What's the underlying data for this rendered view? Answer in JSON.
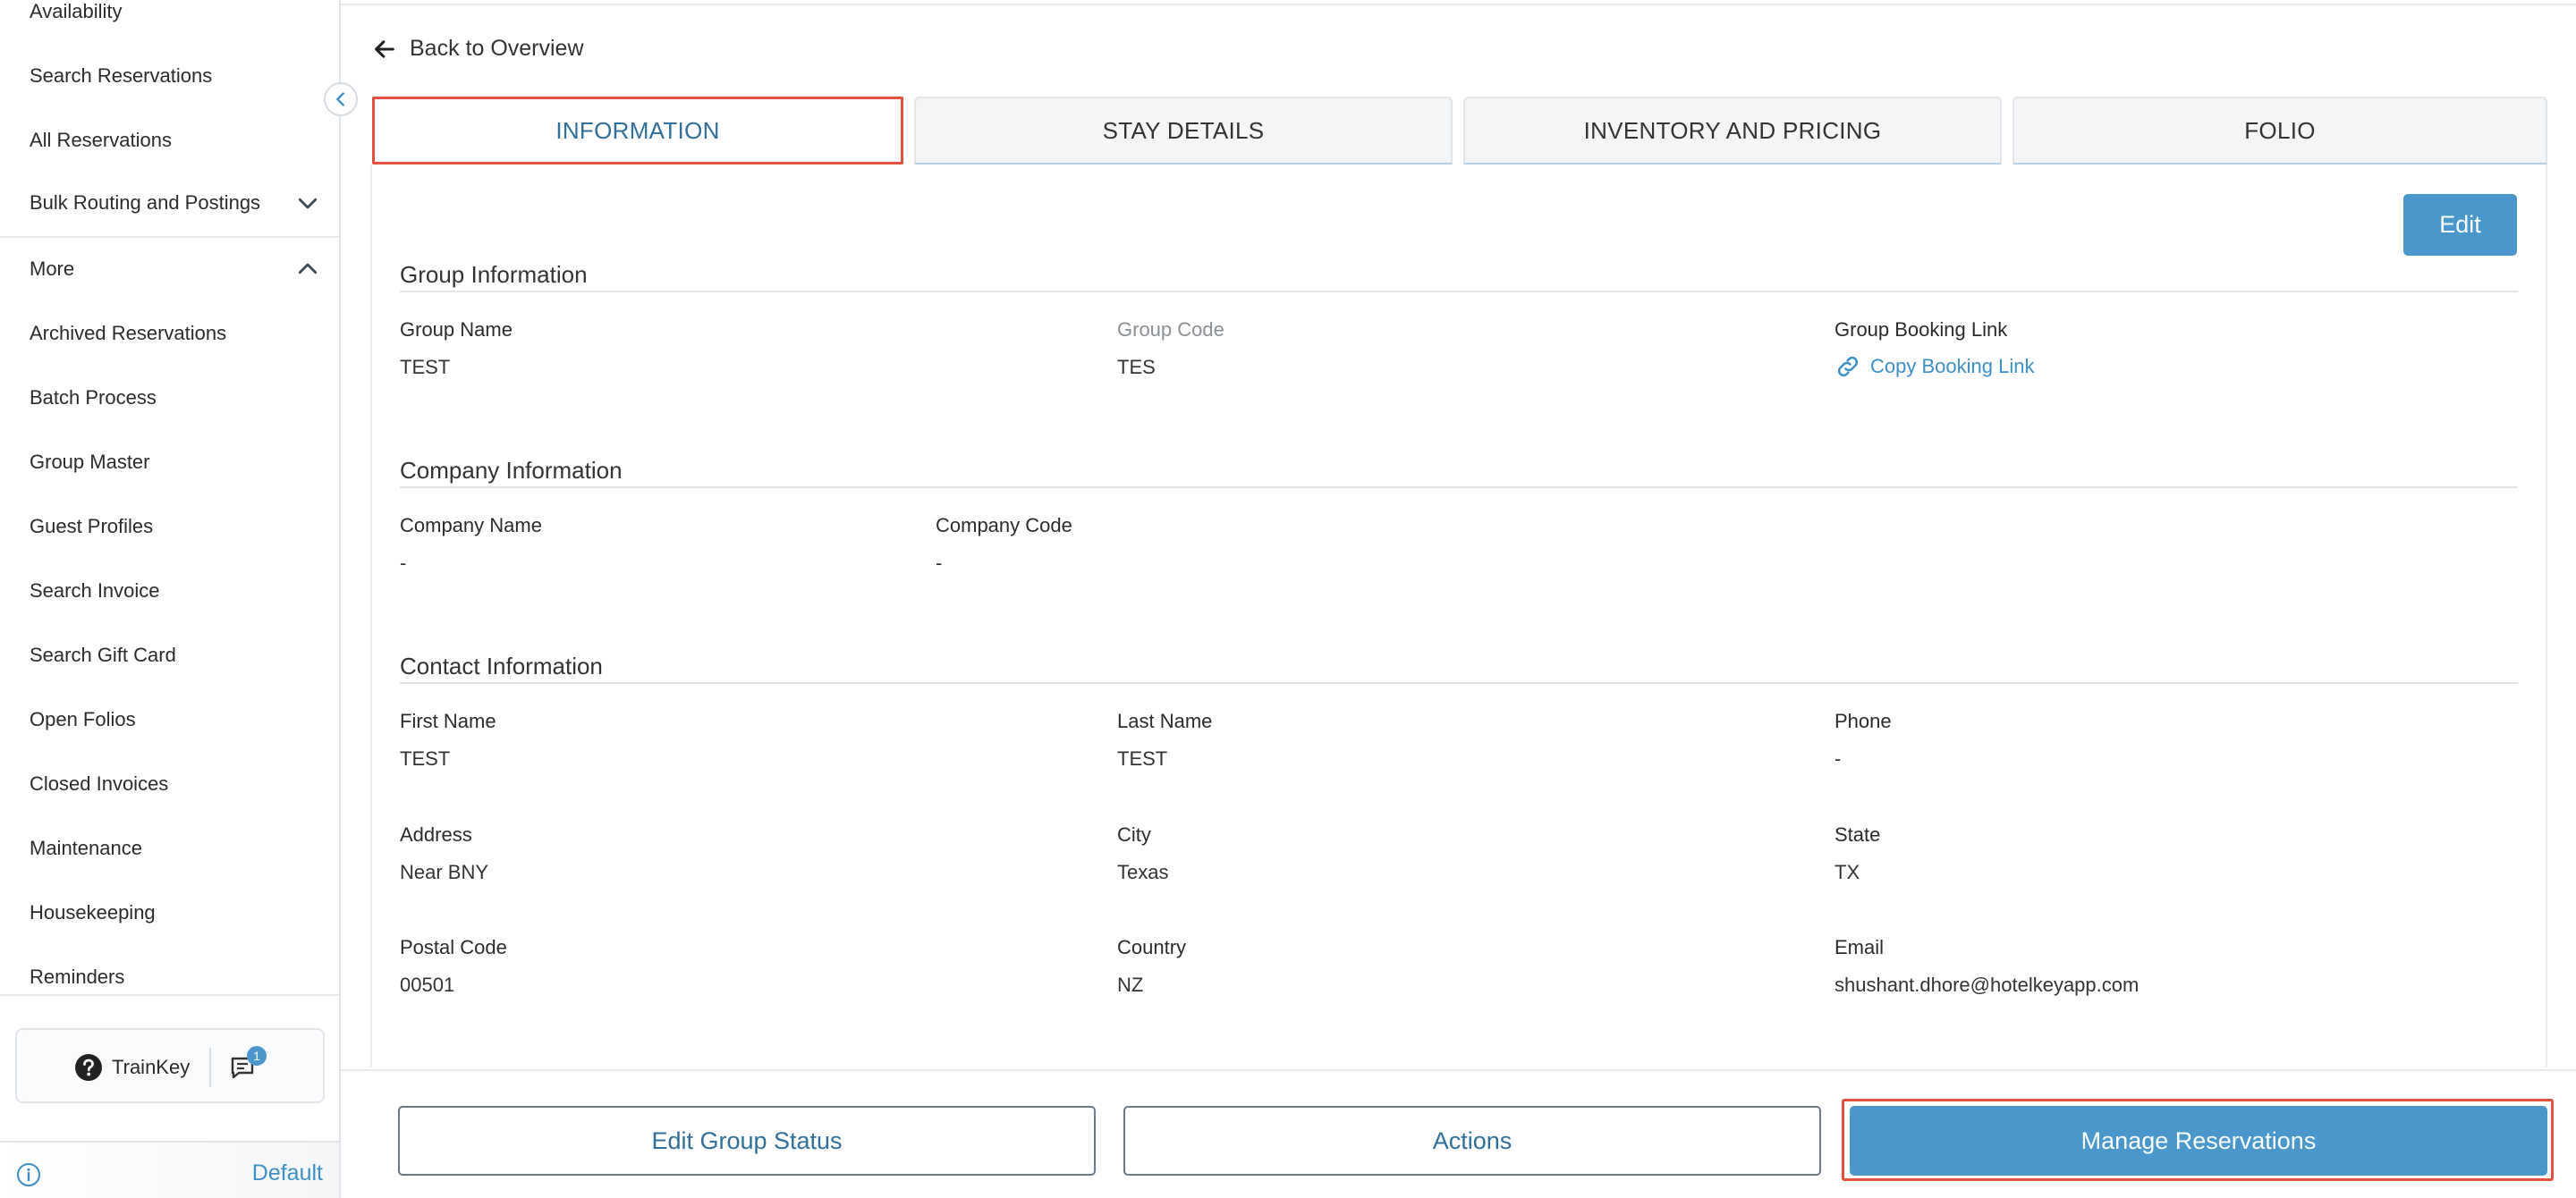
{
  "sidebar": {
    "items": [
      {
        "label": "Availability"
      },
      {
        "label": "Search Reservations"
      },
      {
        "label": "All Reservations"
      },
      {
        "label": "Bulk Routing and Postings"
      },
      {
        "label": "More"
      },
      {
        "label": "Archived Reservations"
      },
      {
        "label": "Batch Process"
      },
      {
        "label": "Group Master"
      },
      {
        "label": "Guest Profiles"
      },
      {
        "label": "Search Invoice"
      },
      {
        "label": "Search Gift Card"
      },
      {
        "label": "Open Folios"
      },
      {
        "label": "Closed Invoices"
      },
      {
        "label": "Maintenance"
      },
      {
        "label": "Housekeeping"
      },
      {
        "label": "Reminders"
      }
    ],
    "trainkey_label": "TrainKey",
    "chat_badge": "1",
    "footer_label": "Default"
  },
  "header": {
    "back_label": "Back to Overview"
  },
  "tabs": [
    {
      "label": "INFORMATION",
      "active": true
    },
    {
      "label": "STAY DETAILS",
      "active": false
    },
    {
      "label": "INVENTORY AND PRICING",
      "active": false
    },
    {
      "label": "FOLIO",
      "active": false
    }
  ],
  "edit_label": "Edit",
  "group_info": {
    "title": "Group Information",
    "group_name_label": "Group Name",
    "group_name": "TEST",
    "group_code_label": "Group Code",
    "group_code": "TES",
    "booking_link_label": "Group Booking Link",
    "booking_link_text": "Copy Booking Link"
  },
  "company_info": {
    "title": "Company Information",
    "company_name_label": "Company Name",
    "company_name": "-",
    "company_code_label": "Company Code",
    "company_code": "-"
  },
  "contact_info": {
    "title": "Contact Information",
    "first_name_label": "First Name",
    "first_name": "TEST",
    "last_name_label": "Last Name",
    "last_name": "TEST",
    "phone_label": "Phone",
    "phone": "-",
    "address_label": "Address",
    "address": "Near BNY",
    "city_label": "City",
    "city": "Texas",
    "state_label": "State",
    "state": "TX",
    "postal_label": "Postal Code",
    "postal": "00501",
    "country_label": "Country",
    "country": "NZ",
    "email_label": "Email",
    "email": "shushant.dhore@hotelkeyapp.com"
  },
  "bottom": {
    "edit_status_label": "Edit Group Status",
    "actions_label": "Actions",
    "manage_label": "Manage Reservations"
  },
  "colors": {
    "accent": "#4a97cc",
    "highlight": "#e0513e",
    "link": "#3d8fc7"
  }
}
